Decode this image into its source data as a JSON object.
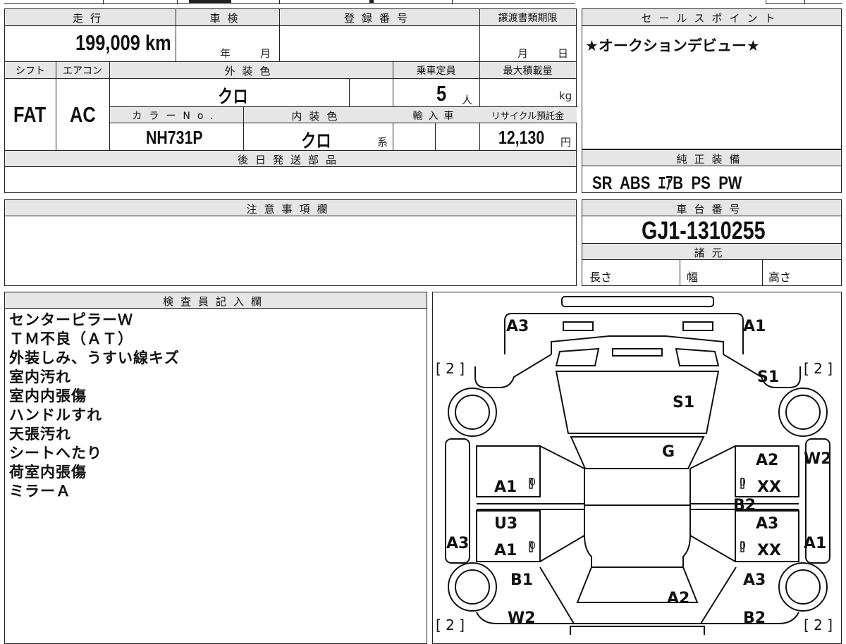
{
  "headers": {
    "mileage": "走行",
    "inspection": "車検",
    "registration": "登録番号",
    "transfer_deadline": "譲渡書類期限",
    "sales_point": "セールスポイント",
    "shift": "シフト",
    "aircon": "エアコン",
    "exterior_color": "外装色",
    "capacity": "乗車定員",
    "max_load": "最大積載量",
    "color_no": "カラーNo.",
    "interior_color": "内装色",
    "import": "輸入車",
    "recycle_fee": "リサイクル預託金",
    "later_parts": "後日発送部品",
    "standard_equipment": "純正装備",
    "notes": "注意事項欄",
    "chassis_no": "車台番号",
    "specs": "諸元",
    "inspector": "検査員記入欄"
  },
  "vehicle": {
    "mileage": "199,009 km",
    "inspection_year_unit": "年",
    "inspection_month_unit": "月",
    "deadline_month_unit": "月",
    "deadline_day_unit": "日",
    "shift": "FAT",
    "aircon": "AC",
    "exterior_color": "クロ",
    "capacity": "5",
    "capacity_unit": "人",
    "max_load_unit": "kg",
    "color_no": "NH731P",
    "interior_color": "クロ",
    "interior_suffix": "系",
    "recycle_fee": "12,130",
    "recycle_unit": "円",
    "chassis_no": "GJ1-1310255"
  },
  "sales_point_text": "★オークションデビュー★",
  "standard_equipment": "SR  ABS  ｴｱB  PS  PW",
  "specs": {
    "length": "長さ",
    "width": "幅",
    "height": "高さ"
  },
  "inspector_notes": [
    "センターピラーＷ",
    "ＴＭ不良（ＡＴ）",
    "外装しみ、うすい線キズ",
    "室内汚れ",
    "室内内張傷",
    "ハンドルすれ",
    "天張汚れ",
    "シートへたり",
    "荷室内張傷",
    "ミラーＡ"
  ],
  "diagram": {
    "labels": {
      "top_left": "A3",
      "top_right": "A1",
      "bracket_tl": "[ 2 ]",
      "bracket_tr": "[ 2 ]",
      "bracket_bl": "[ 2 ]",
      "bracket_br": "[ 2 ]",
      "right_fender": "S1",
      "hood": "S1",
      "windshield": "G",
      "right_front_door_1": "A2",
      "right_front_door_2": "XX",
      "right_front_door_mark": "0",
      "center_pillar_right": "B2",
      "right_rear_door_1": "A3",
      "right_rear_door_2": "XX",
      "right_rear_door_mark": "0",
      "right_step": "W2",
      "right_sill": "A1",
      "left_front_door": "A1",
      "left_front_door_mark": "0",
      "left_rear_door_1": "U3",
      "left_rear_door_2": "A1",
      "left_rear_door_mark": "0",
      "left_sill": "A3",
      "left_quarter": "B1",
      "left_rear": "W2",
      "right_quarter": "A3",
      "roof_rear": "A2",
      "right_rear": "B2"
    }
  }
}
